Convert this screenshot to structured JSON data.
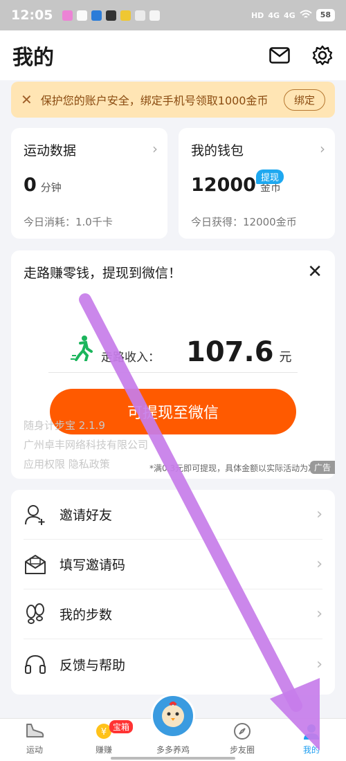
{
  "status": {
    "time": "12:05",
    "battery": "58",
    "net1": "HD",
    "net2": "4G",
    "net3": "4G"
  },
  "header": {
    "title": "我的"
  },
  "banner": {
    "text": "保护您的账户安全，绑定手机号领取1000金币",
    "button": "绑定"
  },
  "stats": {
    "sport": {
      "title": "运动数据",
      "value": "0",
      "unit": "分钟",
      "sub": "今日消耗：1.0千卡"
    },
    "wallet": {
      "title": "我的钱包",
      "value": "12000",
      "unit": "金币",
      "badge": "提现",
      "sub": "今日获得：12000金币"
    }
  },
  "promo": {
    "title": "走路赚零钱，提现到微信！",
    "earn_label": "走路收入：",
    "earn_value": "107.6",
    "earn_unit": "元",
    "button": "可提现至微信",
    "app_version": "随身计步宝 2.1.9",
    "company": "广州卓丰网络科技有限公司",
    "links": "应用权限 隐私政策",
    "note": "*满0.3元即可提现，具体金额以实际活动为准",
    "ad_tag": "广告"
  },
  "menu": [
    {
      "label": "邀请好友",
      "icon": "invite-user-icon"
    },
    {
      "label": "填写邀请码",
      "icon": "invite-code-icon"
    },
    {
      "label": "我的步数",
      "icon": "footprints-icon"
    },
    {
      "label": "反馈与帮助",
      "icon": "headphones-icon"
    }
  ],
  "tabs": [
    {
      "label": "运动",
      "icon": "shoe-icon"
    },
    {
      "label": "赚赚",
      "icon": "coin-icon",
      "badge": "宝箱"
    },
    {
      "label": "多多养鸡",
      "icon": "chick-icon"
    },
    {
      "label": "步友圈",
      "icon": "compass-icon"
    },
    {
      "label": "我的",
      "icon": "profile-icon"
    }
  ],
  "colors": {
    "accent": "#ff5a00",
    "active_tab": "#1e9ef0",
    "banner_bg": "#ffe5b4",
    "arrow": "#c77dea"
  }
}
